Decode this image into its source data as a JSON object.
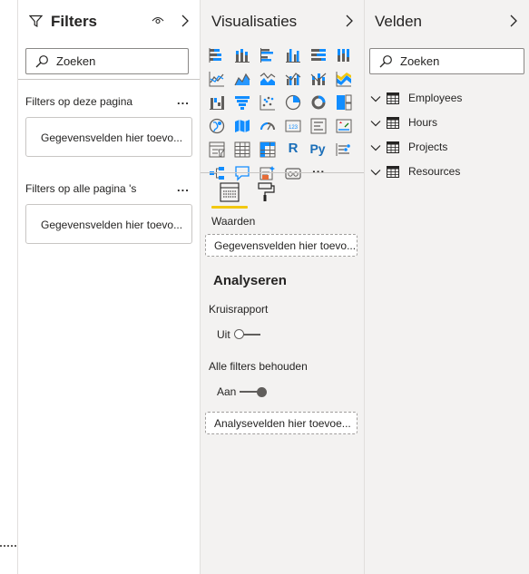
{
  "filters": {
    "title": "Filters",
    "search_placeholder": "Zoeken",
    "page_filters_label": "Filters op deze pagina",
    "page_filters_well": "Gegevensvelden hier toevo...",
    "all_pages_label": "Filters op alle pagina 's",
    "all_pages_well": "Gegevensvelden hier toevo...",
    "more": "..."
  },
  "visualizations": {
    "title": "Visualisaties",
    "icons": [
      "stacked-bar-chart-icon",
      "stacked-column-chart-icon",
      "clustered-bar-chart-icon",
      "clustered-column-chart-icon",
      "100-stacked-bar-chart-icon",
      "100-stacked-column-chart-icon",
      "line-chart-icon",
      "area-chart-icon",
      "stacked-area-chart-icon",
      "line-clustered-column-icon",
      "line-stacked-column-icon",
      "ribbon-chart-icon",
      "waterfall-chart-icon",
      "funnel-chart-icon",
      "scatter-chart-icon",
      "pie-chart-icon",
      "donut-chart-icon",
      "treemap-icon",
      "map-icon",
      "filled-map-icon",
      "gauge-icon",
      "card-icon",
      "multi-row-card-icon",
      "kpi-icon",
      "slicer-icon",
      "table-icon",
      "matrix-icon",
      "r-visual-icon",
      "python-visual-icon",
      "key-influencers-icon",
      "decomposition-tree-icon",
      "qa-icon",
      "smart-narrative-icon",
      "paginated-report-icon",
      "more-visuals-icon"
    ],
    "r_label": "R",
    "py_label": "Py",
    "more_label": "···",
    "values_label": "Waarden",
    "values_well": "Gegevensvelden hier toevo...",
    "analyze_heading": "Analyseren",
    "cross_report_label": "Kruisrapport",
    "cross_report_state": "Uit",
    "keep_filters_label": "Alle filters behouden",
    "keep_filters_state": "Aan",
    "drillthrough_well": "Analysevelden hier toevoe..."
  },
  "fields": {
    "title": "Velden",
    "search_placeholder": "Zoeken",
    "tables": [
      "Employees",
      "Hours",
      "Projects",
      "Resources"
    ]
  },
  "colors": {
    "accent_blue": "#118dff",
    "yellow": "#f2c811",
    "pane_bg": "#f3f2f1"
  }
}
